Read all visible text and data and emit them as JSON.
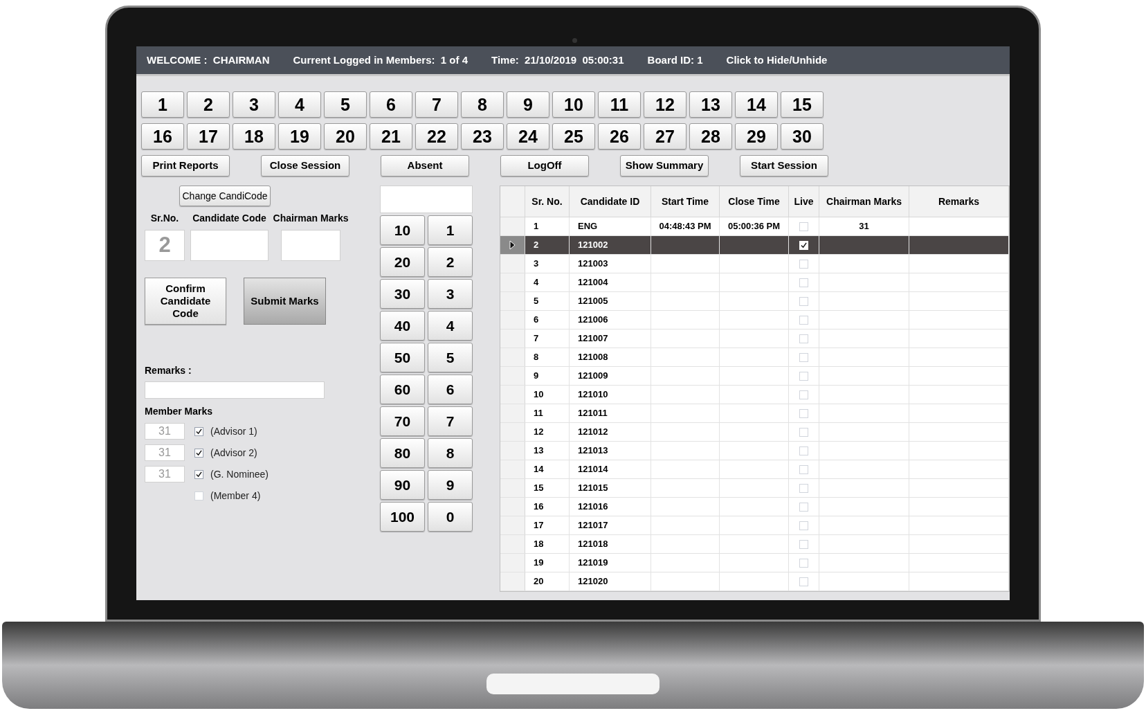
{
  "header": {
    "items": [
      "WELCOME :  CHAIRMAN",
      "Current Logged in Members:  1 of 4",
      "Time:  21/10/2019  05:00:31",
      "Board ID: 1",
      "Click to Hide/Unhide"
    ]
  },
  "number_buttons": [
    "1",
    "2",
    "3",
    "4",
    "5",
    "6",
    "7",
    "8",
    "9",
    "10",
    "11",
    "12",
    "13",
    "14",
    "15",
    "16",
    "17",
    "18",
    "19",
    "20",
    "21",
    "22",
    "23",
    "24",
    "25",
    "26",
    "27",
    "28",
    "29",
    "30"
  ],
  "action_buttons": [
    "Print Reports",
    "Close Session",
    "Absent",
    "LogOff",
    "Show Summary",
    "Start Session"
  ],
  "entry": {
    "change_button": "Change CandiCode",
    "sr_no_label": "Sr.No.",
    "sr_no_value": "2",
    "candidate_code_label": "Candidate Code",
    "chairman_marks_label": "Chairman Marks",
    "confirm_button": "Confirm Candidate Code",
    "submit_button": "Submit Marks",
    "remarks_label": "Remarks :",
    "member_marks_label": "Member Marks"
  },
  "members": [
    {
      "marks": "31",
      "checked": true,
      "label": "(Advisor 1)"
    },
    {
      "marks": "31",
      "checked": true,
      "label": "(Advisor 2)"
    },
    {
      "marks": "31",
      "checked": true,
      "label": "(G. Nominee)"
    },
    {
      "checked": false,
      "label": "(Member 4)"
    }
  ],
  "keypad": [
    [
      "10",
      "1"
    ],
    [
      "20",
      "2"
    ],
    [
      "30",
      "3"
    ],
    [
      "40",
      "4"
    ],
    [
      "50",
      "5"
    ],
    [
      "60",
      "6"
    ],
    [
      "70",
      "7"
    ],
    [
      "80",
      "8"
    ],
    [
      "90",
      "9"
    ],
    [
      "100",
      "0"
    ]
  ],
  "table": {
    "columns": [
      "Sr. No.",
      "Candidate ID",
      "Start Time",
      "Close Time",
      "Live",
      "Chairman Marks",
      "Remarks"
    ],
    "rows": [
      {
        "sr": "1",
        "id": "ENG",
        "start": "04:48:43 PM",
        "close": "05:00:36 PM",
        "live": false,
        "marks": "31",
        "selected": false
      },
      {
        "sr": "2",
        "id": "121002",
        "live": true,
        "selected": true
      },
      {
        "sr": "3",
        "id": "121003",
        "live": false,
        "selected": false
      },
      {
        "sr": "4",
        "id": "121004",
        "live": false,
        "selected": false
      },
      {
        "sr": "5",
        "id": "121005",
        "live": false,
        "selected": false
      },
      {
        "sr": "6",
        "id": "121006",
        "live": false,
        "selected": false
      },
      {
        "sr": "7",
        "id": "121007",
        "live": false,
        "selected": false
      },
      {
        "sr": "8",
        "id": "121008",
        "live": false,
        "selected": false
      },
      {
        "sr": "9",
        "id": "121009",
        "live": false,
        "selected": false
      },
      {
        "sr": "10",
        "id": "121010",
        "live": false,
        "selected": false
      },
      {
        "sr": "11",
        "id": "121011",
        "live": false,
        "selected": false
      },
      {
        "sr": "12",
        "id": "121012",
        "live": false,
        "selected": false
      },
      {
        "sr": "13",
        "id": "121013",
        "live": false,
        "selected": false
      },
      {
        "sr": "14",
        "id": "121014",
        "live": false,
        "selected": false
      },
      {
        "sr": "15",
        "id": "121015",
        "live": false,
        "selected": false
      },
      {
        "sr": "16",
        "id": "121016",
        "live": false,
        "selected": false
      },
      {
        "sr": "17",
        "id": "121017",
        "live": false,
        "selected": false
      },
      {
        "sr": "18",
        "id": "121018",
        "live": false,
        "selected": false
      },
      {
        "sr": "19",
        "id": "121019",
        "live": false,
        "selected": false
      },
      {
        "sr": "20",
        "id": "121020",
        "live": false,
        "selected": false
      }
    ]
  }
}
